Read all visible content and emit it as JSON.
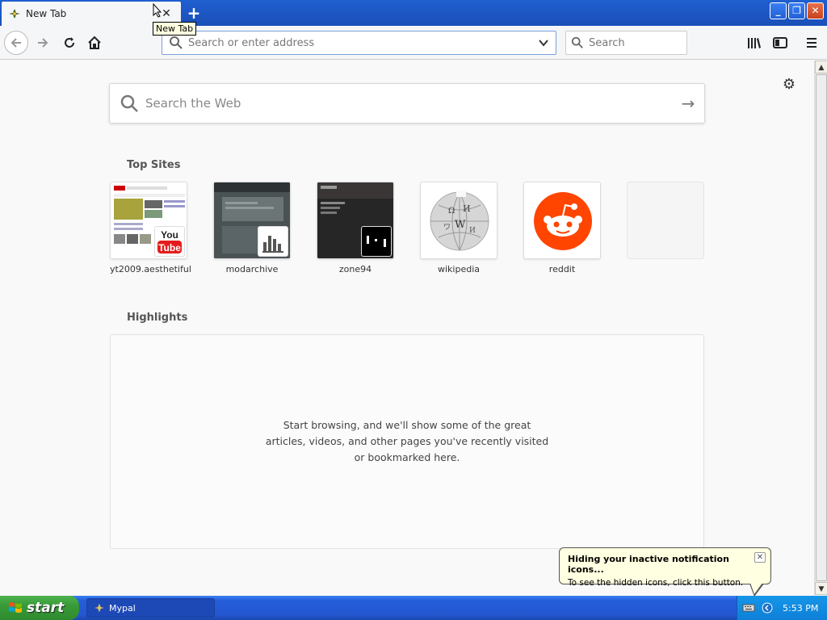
{
  "colors": {
    "titlebar": "#1f5fd0",
    "accent": "#0a84ff",
    "reddit": "#ff4500",
    "start_green": "#389a38"
  },
  "tab": {
    "title": "New Tab",
    "tooltip": "New Tab"
  },
  "navbar": {
    "url_placeholder": "Search or enter address",
    "search_placeholder": "Search"
  },
  "newtab": {
    "web_search_placeholder": "Search the Web",
    "top_sites_title": "Top Sites",
    "top_sites": [
      {
        "label": "yt2009.aesthetiful",
        "icon": "youtube-icon"
      },
      {
        "label": "modarchive",
        "icon": "modarchive-icon"
      },
      {
        "label": "zone94",
        "icon": "zone94-icon"
      },
      {
        "label": "wikipedia",
        "icon": "wikipedia-icon"
      },
      {
        "label": "reddit",
        "icon": "reddit-icon"
      }
    ],
    "highlights_title": "Highlights",
    "highlights_empty": "Start browsing, and we'll show some of the great articles, videos, and other pages you've recently visited or bookmarked here."
  },
  "balloon": {
    "title": "Hiding your inactive notification icons...",
    "body": "To see the hidden icons, click this button."
  },
  "taskbar": {
    "start_label": "start",
    "task_label": "Mypal",
    "clock": "5:53 PM"
  }
}
